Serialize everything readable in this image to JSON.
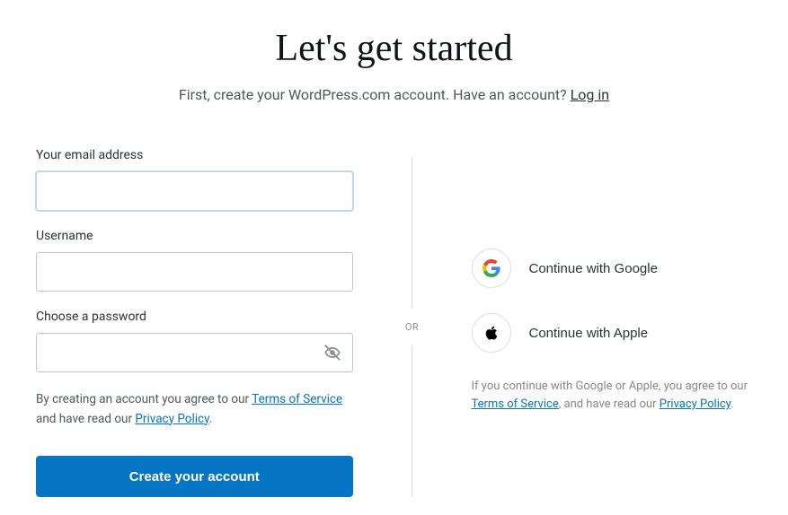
{
  "header": {
    "title": "Let's get started",
    "subtitle_prefix": "First, create your WordPress.com account. Have an account? ",
    "login_link": "Log in"
  },
  "form": {
    "email_label": "Your email address",
    "email_value": "",
    "username_label": "Username",
    "username_value": "",
    "password_label": "Choose a password",
    "password_value": "",
    "legal_prefix": "By creating an account you agree to our ",
    "terms_link": "Terms of Service",
    "legal_mid": " and have read our ",
    "privacy_link": "Privacy Policy",
    "legal_suffix": ".",
    "submit_label": "Create your account"
  },
  "divider": {
    "or_label": "OR"
  },
  "social": {
    "google_label": "Continue with Google",
    "apple_label": "Continue with Apple",
    "legal_prefix": "If you continue with Google or Apple, you agree to our ",
    "terms_link": "Terms of Service",
    "legal_mid": ", and have read our ",
    "privacy_link": "Privacy Policy",
    "legal_suffix": "."
  }
}
